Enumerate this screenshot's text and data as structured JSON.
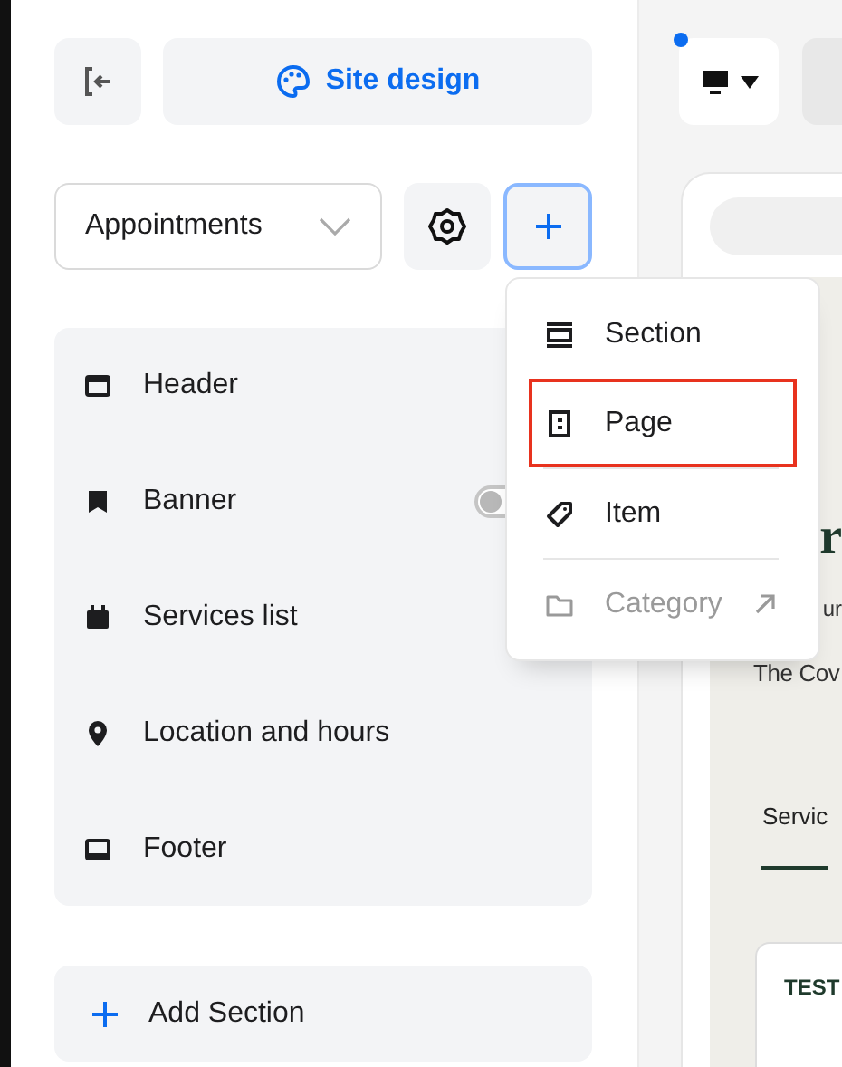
{
  "sidebar": {
    "site_design": {
      "label": "Site design"
    },
    "page_select": {
      "value": "Appointments"
    },
    "add_menu_open": true,
    "sections": [
      {
        "label": "Header",
        "kind": "header"
      },
      {
        "label": "Banner",
        "kind": "banner",
        "toggle": {
          "on": false
        }
      },
      {
        "label": "Services list",
        "kind": "calendar"
      },
      {
        "label": "Location and hours",
        "kind": "pin"
      },
      {
        "label": "Footer",
        "kind": "footer"
      }
    ],
    "add_section": {
      "label": "Add Section"
    }
  },
  "add_menu": {
    "items": [
      {
        "label": "Section",
        "kind": "section",
        "selected": false,
        "disabled": false
      },
      {
        "label": "Page",
        "kind": "page",
        "selected": true,
        "disabled": false
      },
      {
        "label": "Item",
        "kind": "tag",
        "selected": false,
        "disabled": false
      },
      {
        "label": "Category",
        "kind": "folder",
        "selected": false,
        "disabled": true,
        "external": true
      }
    ]
  },
  "preview": {
    "unsaved": true,
    "heading": "r",
    "subtitle": "ur",
    "text": "The Cov",
    "tabs": [
      {
        "label": "Servic",
        "selected": true
      }
    ],
    "card": {
      "title": "TEST"
    }
  }
}
